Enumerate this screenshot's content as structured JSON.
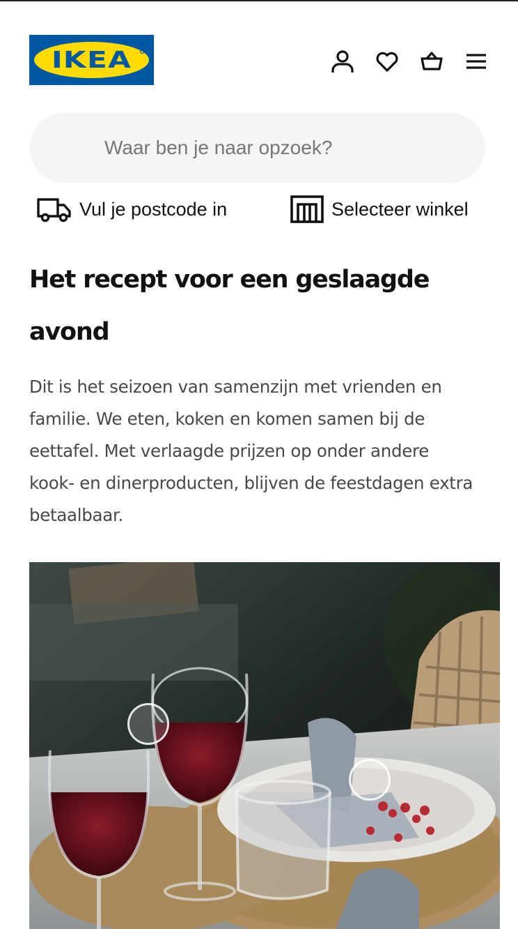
{
  "brand": {
    "logo_text": "IKEA",
    "colors": {
      "blue": "#0058a3",
      "yellow": "#ffdb00"
    }
  },
  "header": {
    "icons": [
      {
        "name": "account-icon",
        "label": "Account"
      },
      {
        "name": "heart-icon",
        "label": "Favorieten"
      },
      {
        "name": "basket-icon",
        "label": "Winkelwagen"
      },
      {
        "name": "menu-icon",
        "label": "Menu"
      }
    ]
  },
  "search": {
    "placeholder": "Waar ben je naar opzoek?"
  },
  "location": {
    "postcode_label": "Vul je postcode in",
    "store_label": "Selecteer winkel"
  },
  "article": {
    "title": "Het recept voor een geslaagde avond",
    "intro": "Dit is het seizoen van samenzijn met vrienden en familie. We eten, koken en komen samen bij de eettafel. Met verlaagde prijzen op onder andere kook- en dinerproducten, blijven de feestdagen extra betaalbaar."
  },
  "hero_image": {
    "hotspot_count": 2
  }
}
